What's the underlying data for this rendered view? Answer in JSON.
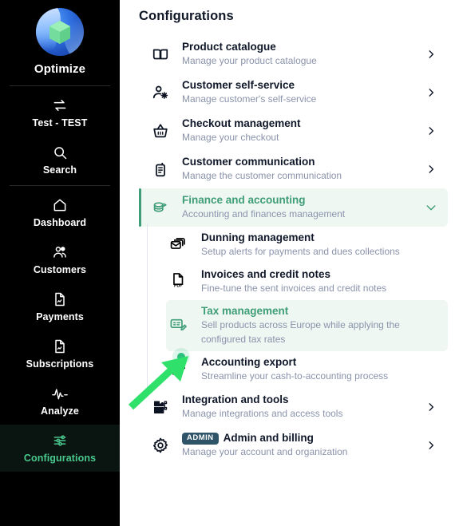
{
  "sidebar": {
    "brand": {
      "name": "Optimize",
      "logo_icon": "optimize-logo"
    },
    "items": [
      {
        "label": "Test - TEST",
        "icon": "switch-arrows-icon",
        "active": false
      },
      {
        "label": "Search",
        "icon": "search-icon",
        "active": false
      },
      {
        "label": "Dashboard",
        "icon": "home-icon",
        "active": false
      },
      {
        "label": "Customers",
        "icon": "users-icon",
        "active": false
      },
      {
        "label": "Payments",
        "icon": "document-chart-icon",
        "active": false
      },
      {
        "label": "Subscriptions",
        "icon": "document-chart-icon",
        "active": false
      },
      {
        "label": "Analyze",
        "icon": "pulse-icon",
        "active": false
      },
      {
        "label": "Configurations",
        "icon": "sliders-icon",
        "active": true
      }
    ]
  },
  "main": {
    "title": "Configurations",
    "rows": [
      {
        "title": "Product catalogue",
        "subtitle": "Manage your product catalogue",
        "icon": "book-icon",
        "chevron": "chevron-right-icon"
      },
      {
        "title": "Customer self-service",
        "subtitle": "Manage customer's self-service",
        "icon": "user-gear-icon",
        "chevron": "chevron-right-icon"
      },
      {
        "title": "Checkout management",
        "subtitle": "Manage your checkout",
        "icon": "basket-icon",
        "chevron": "chevron-right-icon"
      },
      {
        "title": "Customer communication",
        "subtitle": "Manage the customer communication",
        "icon": "radio-icon",
        "chevron": "chevron-right-icon"
      }
    ],
    "expanded_row": {
      "title": "Finance and accounting",
      "subtitle": "Accounting and finances management",
      "icon": "coins-icon",
      "chevron": "chevron-down-icon"
    },
    "sub_rows": [
      {
        "title": "Dunning management",
        "subtitle": "Setup alerts for payments and dues collections",
        "icon": "mail-stack-icon",
        "selected": false,
        "badge_dot": false
      },
      {
        "title": "Invoices and credit notes",
        "subtitle": "Fine-tune the sent invoices and credit notes",
        "icon": "pdf-file-icon",
        "selected": false,
        "badge_dot": false
      },
      {
        "title": "Tax management",
        "subtitle": "Sell products across Europe while applying the configured tax rates",
        "icon": "tax-receipt-edit-icon",
        "selected": true,
        "badge_dot": false
      },
      {
        "title": "Accounting export",
        "subtitle": "Streamline your cash-to-accounting process",
        "icon": "export-arrow-icon",
        "selected": false,
        "badge_dot": true
      }
    ],
    "tail_rows": [
      {
        "title": "Integration and tools",
        "subtitle": "Manage integrations and access tools",
        "icon": "puzzle-icon",
        "chevron": "chevron-right-icon",
        "badge": null
      },
      {
        "title": "Admin and billing",
        "subtitle": "Manage your account and organization",
        "icon": "gear-icon",
        "chevron": "chevron-right-icon",
        "badge": "ADMIN"
      }
    ]
  },
  "annotation": {
    "arrow_icon": "green-pointer-arrow",
    "color": "#2fe16a"
  },
  "colors": {
    "accent_green": "#3f9d77",
    "sidebar_active_text": "#49c98e",
    "sidebar_bg": "#000000",
    "highlight_bg": "#eef7f2",
    "subtitle": "#8a93ab",
    "title": "#0f1729",
    "badge_admin_bg": "#2f5468"
  }
}
